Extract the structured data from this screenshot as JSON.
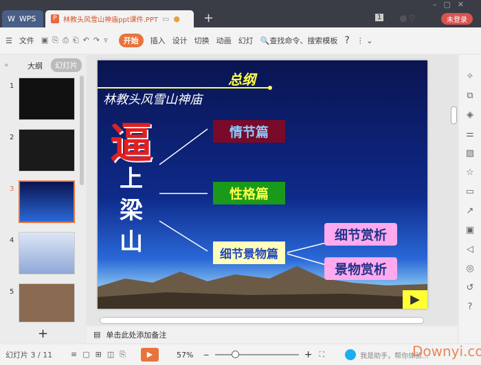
{
  "window": {
    "app_tab": "WPS",
    "doc_tab": "林教头风雪山神庙ppt课件.PPT",
    "login": "未登录",
    "page_badge": "1"
  },
  "toolbar": {
    "file": "文件",
    "tabs": [
      "开始",
      "插入",
      "设计",
      "切换",
      "动画",
      "幻灯"
    ],
    "search": "查找命令、搜索模板",
    "help": "?"
  },
  "left": {
    "tabs": [
      "大纲",
      "幻灯片"
    ],
    "slide_numbers": [
      "1",
      "2",
      "3",
      "4",
      "5"
    ],
    "current": 2
  },
  "slide": {
    "title": "总纲",
    "subtitle": "林教头风雪山神庙",
    "big_char": "逼",
    "vertical": [
      "上",
      "梁",
      "山"
    ],
    "boxes": [
      "情节篇",
      "性格篇",
      "细节景物篇",
      "细节赏析",
      "景物赏析"
    ]
  },
  "notes": {
    "placeholder": "单击此处添加备注"
  },
  "status": {
    "slide_count": "幻灯片 3 / 11",
    "zoom": "57%",
    "zoom_level": 0.57,
    "assistant": "我是助手，帮你体验..."
  },
  "watermark": "Downyi.com",
  "colors": {
    "accent": "#e8733d",
    "titlebar": "#3a3d45",
    "slide_bg": "#0e2a8a"
  }
}
